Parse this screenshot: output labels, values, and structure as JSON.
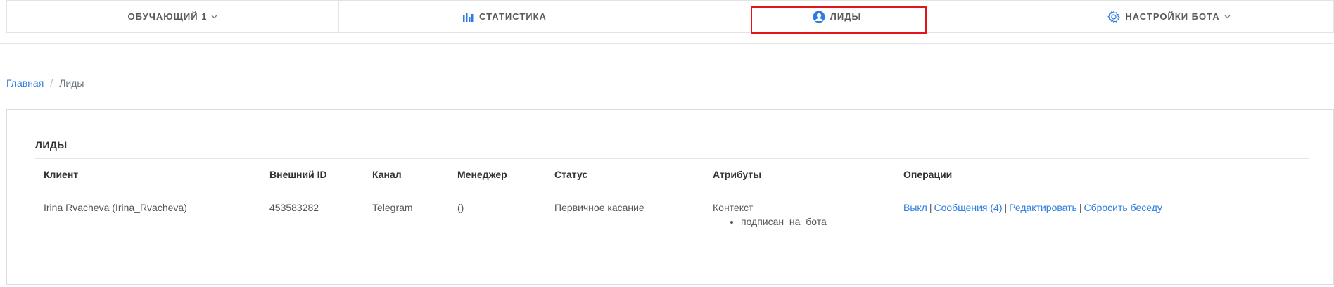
{
  "nav": {
    "items": [
      {
        "label": "ОБУЧАЮЩИЙ 1",
        "icon": "chevron-down-icon"
      },
      {
        "label": "СТАТИСТИКА",
        "icon": "bar-chart-icon"
      },
      {
        "label": "ЛИДЫ",
        "icon": "user-circle-icon"
      },
      {
        "label": "НАСТРОЙКИ БОТА",
        "icon": "gear-icon"
      }
    ],
    "accent": "#2f7de1",
    "highlight_color": "#e3151a"
  },
  "breadcrumb": {
    "home": "Главная",
    "current": "Лиды",
    "separator": "/"
  },
  "card": {
    "title": "ЛИДЫ"
  },
  "table": {
    "headers": [
      "Клиент",
      "Внешний ID",
      "Канал",
      "Менеджер",
      "Статус",
      "Атрибуты",
      "Операции"
    ],
    "rows": [
      {
        "client": "Irina Rvacheva (Irina_Rvacheva)",
        "external_id": "453583282",
        "channel": "Telegram",
        "manager": "()",
        "status": "Первичное касание",
        "attr_title": "Контекст",
        "attr_items": [
          "подписан_на_бота"
        ],
        "ops": {
          "off": "Выкл",
          "messages": "Сообщения (4)",
          "edit": "Редактировать",
          "reset": "Сбросить беседу",
          "pipe": "|"
        }
      }
    ]
  }
}
